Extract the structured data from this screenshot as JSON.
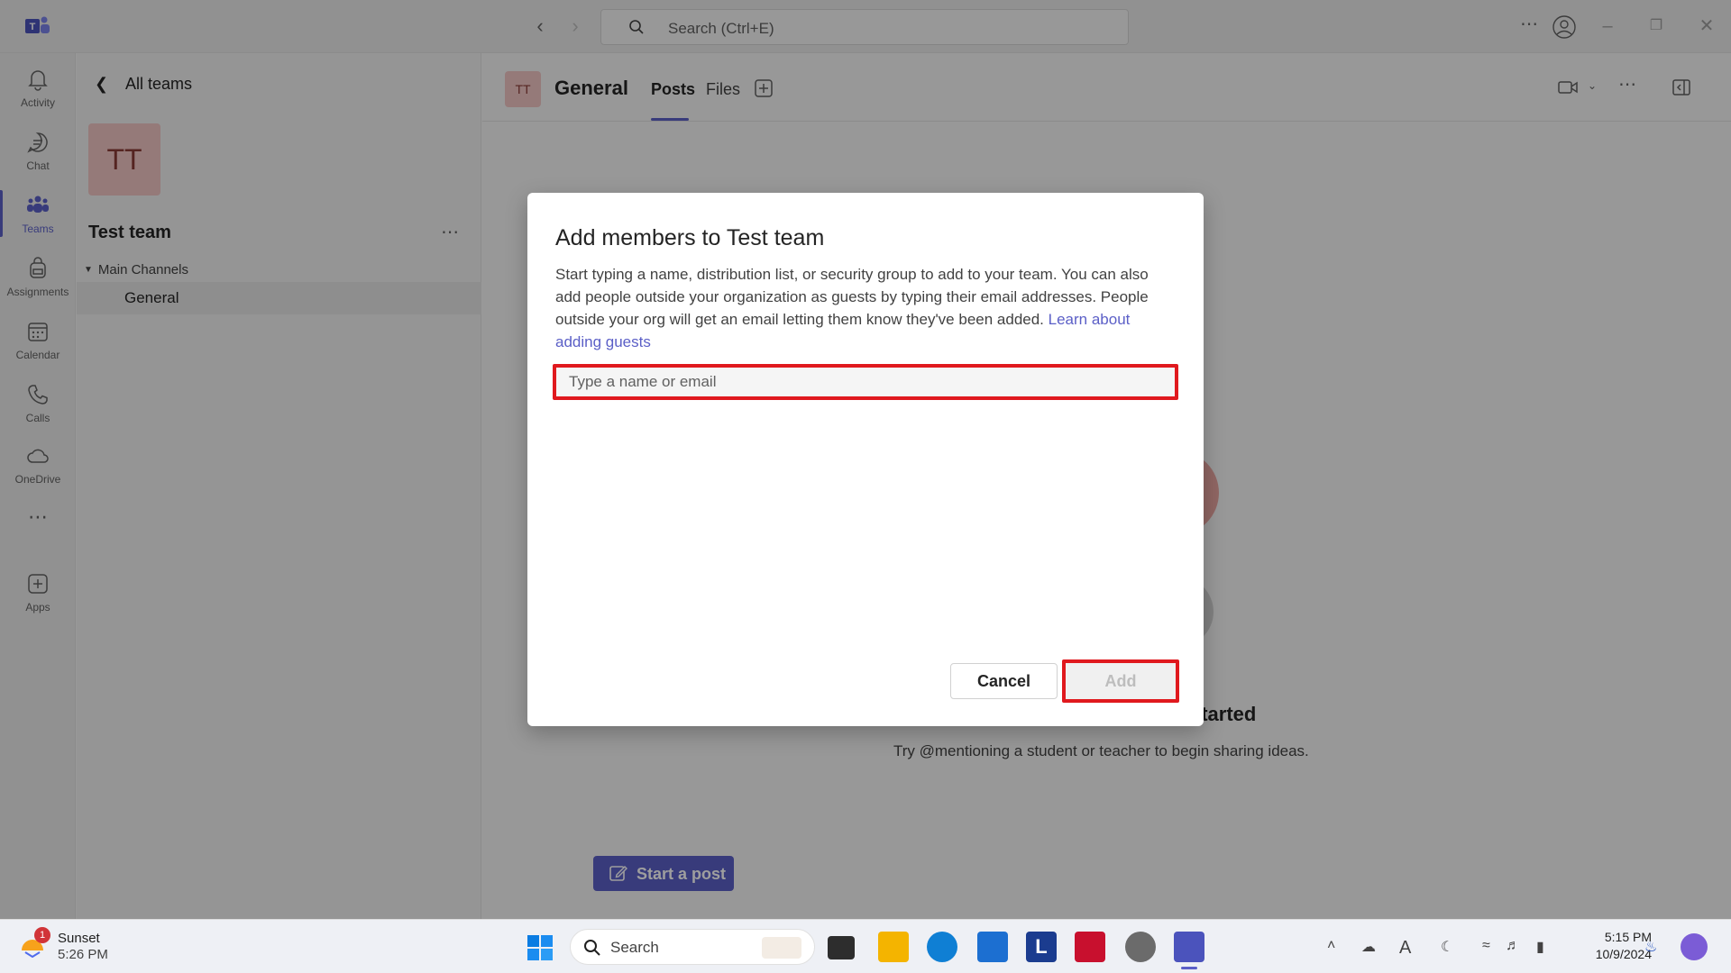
{
  "titlebar": {
    "search_placeholder": "Search (Ctrl+E)"
  },
  "rail": {
    "items": [
      {
        "label": "Activity",
        "icon": "bell-icon"
      },
      {
        "label": "Chat",
        "icon": "chat-icon"
      },
      {
        "label": "Teams",
        "icon": "teams-icon"
      },
      {
        "label": "Assignments",
        "icon": "backpack-icon"
      },
      {
        "label": "Calendar",
        "icon": "calendar-icon"
      },
      {
        "label": "Calls",
        "icon": "phone-icon"
      },
      {
        "label": "OneDrive",
        "icon": "cloud-icon"
      },
      {
        "label": "Apps",
        "icon": "add-app-icon"
      }
    ]
  },
  "teampane": {
    "back_label": "All teams",
    "team_avatar": "TT",
    "team_name": "Test team",
    "channels_header": "Main Channels",
    "channel": "General"
  },
  "channel_header": {
    "avatar": "TT",
    "name": "General",
    "tabs": [
      "Posts",
      "Files"
    ]
  },
  "main": {
    "started_text": "started",
    "try_text": "Try @mentioning a student or teacher to begin sharing ideas.",
    "start_post_label": "Start a post"
  },
  "dialog": {
    "title": "Add members to Test team",
    "description": "Start typing a name, distribution list, or security group to add to your team. You can also add people outside your organization as guests by typing their email addresses. People outside your org will get an email letting them know they've been added.",
    "link_text": "Learn about adding guests",
    "input_placeholder": "Type a name or email",
    "input_value": "",
    "cancel_label": "Cancel",
    "add_label": "Add",
    "highlight_color": "#e0191e"
  },
  "taskbar": {
    "weather_label": "Sunset",
    "weather_time": "5:26 PM",
    "weather_badge": "1",
    "search_label": "Search",
    "time": "5:15 PM",
    "date": "10/9/2024"
  },
  "colors": {
    "accent": "#5b5fc7",
    "avatar_bg": "#f1c6c4"
  }
}
